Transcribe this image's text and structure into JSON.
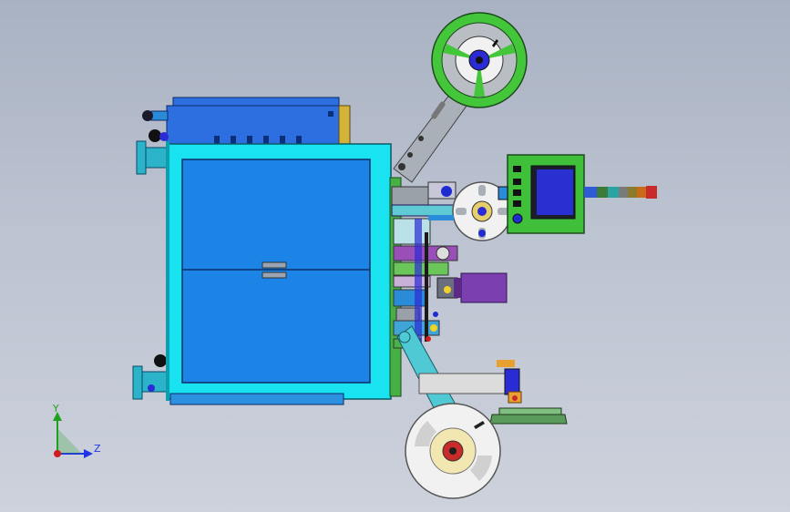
{
  "viewport": {
    "background_top": "#a9b2c3",
    "background_bottom": "#cdd2dc"
  },
  "axis_triad": {
    "y_label": "Y",
    "z_label": "Z",
    "y_color": "#1fa11f",
    "z_color": "#2233e6",
    "origin_color": "#d11c1c"
  },
  "colors": {
    "cabinet_cyan": "#19e3f0",
    "panel_blue": "#1b84e6",
    "top_unit_blue": "#2d6fe0",
    "reel_green": "#43c63a",
    "reel_white": "#f1f1f1",
    "arm_gray": "#aab0b8",
    "hmi_green": "#3fbf3a",
    "hmi_screen": "#2a2fd1",
    "motor_purple": "#7b3fb0"
  },
  "indicator_light_stack": [
    "green-segment",
    "teal-segment",
    "gray-segment",
    "olive-segment",
    "amber-segment",
    "red-segment"
  ],
  "hmi_button_count": 5
}
